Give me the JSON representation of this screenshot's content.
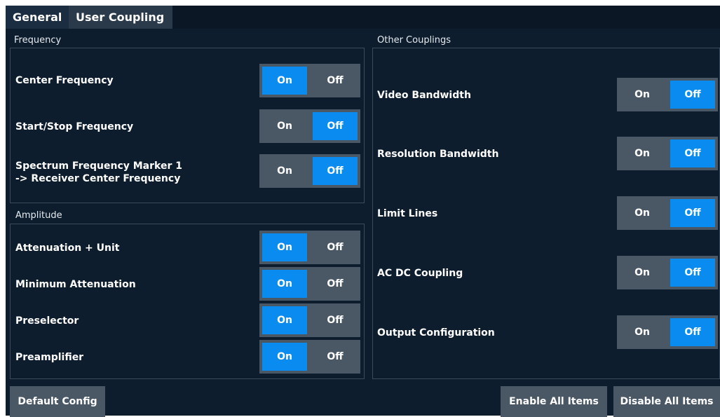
{
  "tabs": [
    {
      "label": "General"
    },
    {
      "label": "User Coupling"
    }
  ],
  "frequency": {
    "title": "Frequency",
    "rows": [
      {
        "label": "Center Frequency",
        "on": "On",
        "off": "Off",
        "state": "on"
      },
      {
        "label": "Start/Stop Frequency",
        "on": "On",
        "off": "Off",
        "state": "off"
      },
      {
        "label_line1": "Spectrum Frequency Marker 1",
        "label_line2": "-> Receiver Center Frequency",
        "on": "On",
        "off": "Off",
        "state": "off"
      }
    ]
  },
  "amplitude": {
    "title": "Amplitude",
    "rows": [
      {
        "label": "Attenuation + Unit",
        "on": "On",
        "off": "Off",
        "state": "on"
      },
      {
        "label": "Minimum Attenuation",
        "on": "On",
        "off": "Off",
        "state": "on"
      },
      {
        "label": "Preselector",
        "on": "On",
        "off": "Off",
        "state": "on"
      },
      {
        "label": "Preamplifier",
        "on": "On",
        "off": "Off",
        "state": "on"
      }
    ]
  },
  "other": {
    "title": "Other Couplings",
    "rows": [
      {
        "label": "Video Bandwidth",
        "on": "On",
        "off": "Off",
        "state": "off"
      },
      {
        "label": "Resolution Bandwidth",
        "on": "On",
        "off": "Off",
        "state": "off"
      },
      {
        "label": "Limit Lines",
        "on": "On",
        "off": "Off",
        "state": "off"
      },
      {
        "label": "AC DC Coupling",
        "on": "On",
        "off": "Off",
        "state": "off"
      },
      {
        "label": "Output Configuration",
        "on": "On",
        "off": "Off",
        "state": "off"
      }
    ]
  },
  "buttons": {
    "default_config": "Default Config",
    "enable_all": "Enable All Items",
    "disable_all": "Disable All Items"
  },
  "colors": {
    "background": "#0d1d2e",
    "toggle_bg": "#4a5866",
    "active_blue": "#0a8bf0"
  }
}
